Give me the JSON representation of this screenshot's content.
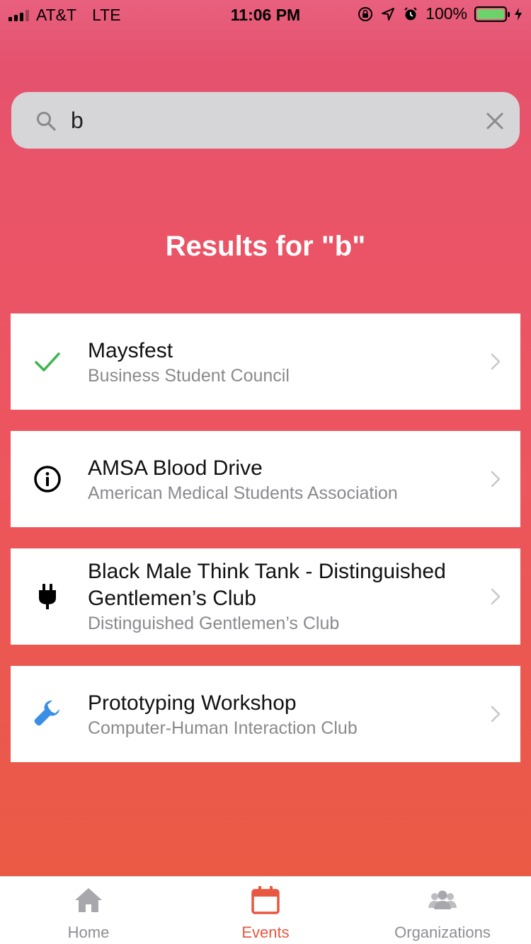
{
  "status_bar": {
    "carrier": "AT&T",
    "network": "LTE",
    "time": "11:06 PM",
    "battery": "100%",
    "signal_bars": 4,
    "signal_bars_active": 3
  },
  "search": {
    "value": "b",
    "placeholder": "",
    "icon": "search-icon",
    "clear_icon": "close-icon"
  },
  "results": {
    "title": "Results for \"b\""
  },
  "events": [
    {
      "title": "Maysfest",
      "organization": "Business Student Council",
      "icon": "checkmark-icon",
      "icon_color": "#3cb54a"
    },
    {
      "title": "AMSA Blood Drive",
      "organization": "American Medical Students Association",
      "icon": "info-icon",
      "icon_color": "#000000"
    },
    {
      "title": "Black Male Think Tank - Distinguished Gentlemen’s Club",
      "organization": "Distinguished Gentlemen’s Club",
      "icon": "plug-icon",
      "icon_color": "#000000"
    },
    {
      "title": "Prototyping Workshop",
      "organization": "Computer-Human Interaction Club",
      "icon": "wrench-icon",
      "icon_color": "#3a8ee6"
    }
  ],
  "tabbar": {
    "tabs": [
      {
        "label": "Home",
        "icon": "home-icon",
        "active": false
      },
      {
        "label": "Events",
        "icon": "calendar-icon",
        "active": true
      },
      {
        "label": "Organizations",
        "icon": "people-icon",
        "active": false
      }
    ]
  },
  "colors": {
    "accent": "#e8573f",
    "gradient_top": "#e8607e",
    "gradient_bottom": "#ea5a44",
    "inactive_tab": "#8e8e93"
  }
}
